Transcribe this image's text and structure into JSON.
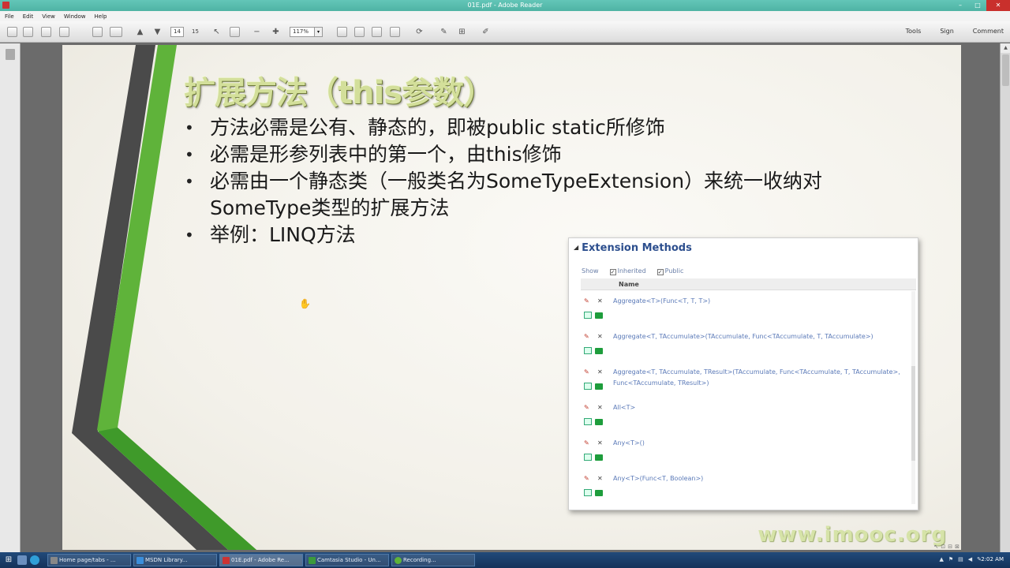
{
  "window": {
    "title": "01E.pdf - Adobe Reader"
  },
  "menu": [
    "File",
    "Edit",
    "View",
    "Window",
    "Help"
  ],
  "toolbar": {
    "page_current": "14",
    "page_total": "15",
    "zoom": "117%",
    "right_links": [
      "Tools",
      "Sign",
      "Comment"
    ]
  },
  "slide": {
    "title": "扩展方法（this参数）",
    "bullets": [
      "方法必需是公有、静态的，即被public static所修饰",
      "必需是形参列表中的第一个，由this修饰",
      "必需由一个静态类（一般类名为SomeTypeExtension）来统一收纳对SomeType类型的扩展方法",
      "举例：LINQ方法"
    ],
    "watermark": "www.imooc.org"
  },
  "panel": {
    "heading": "Extension Methods",
    "filter_label": "Show",
    "filter_inherited": "Inherited",
    "filter_public": "Public",
    "column_name": "Name",
    "methods": [
      "Aggregate<T>(Func<T, T, T>)",
      "Aggregate<T, TAccumulate>(TAccumulate, Func<TAccumulate, T, TAccumulate>)",
      "Aggregate<T, TAccumulate, TResult>(TAccumulate, Func<TAccumulate, T, TAccumulate>, Func<TAccumulate, TResult>)",
      "All<T>",
      "Any<T>()",
      "Any<T>(Func<T, Boolean>)"
    ]
  },
  "taskbar": {
    "tasks": [
      "Home page/tabs - ...",
      "MSDN Library...",
      "01E.pdf - Adobe Re...",
      "Camtasia Studio - Un...",
      "Recording..."
    ],
    "clock": "2:02 AM"
  },
  "colors": {
    "accent_green": "#5fb33a",
    "panel_title": "#2d4f8e",
    "method_link": "#5b7ab8"
  }
}
